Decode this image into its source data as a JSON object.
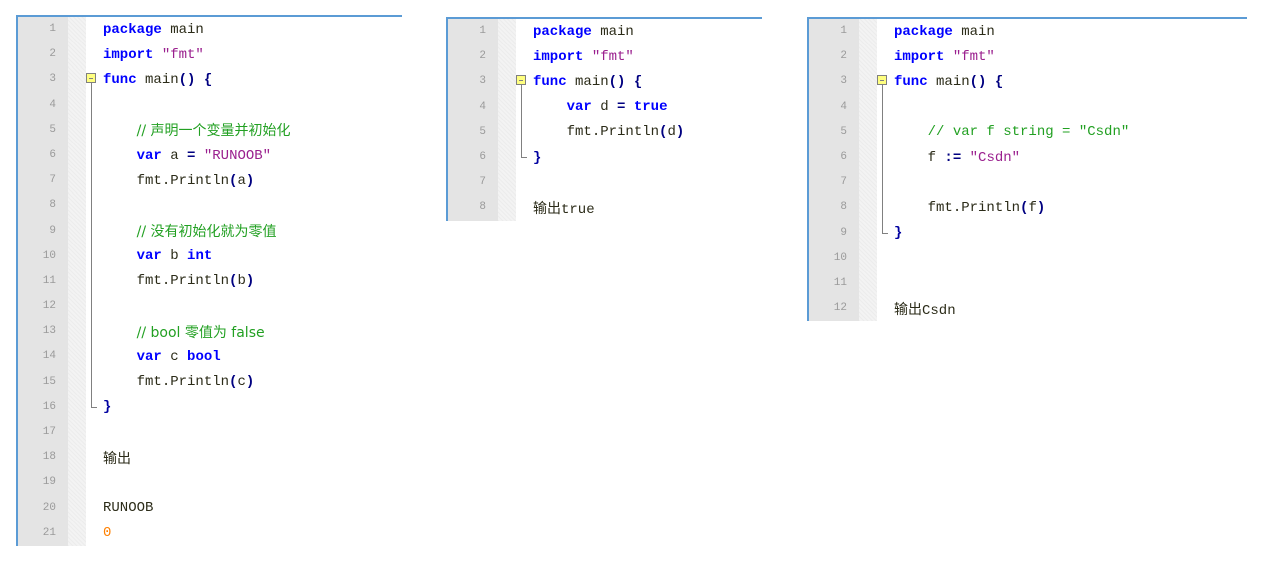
{
  "colors": {
    "panel_border": "#5b9bd5",
    "gutter_bg": "#e4e4e4",
    "line_number": "#9a9a9a",
    "keyword": "#0000ff",
    "string": "#9a1f8e",
    "comment": "#22a022",
    "number": "#ff8000",
    "fold_marker": "#ffff80"
  },
  "panels": [
    {
      "name": "editor-panel-variables",
      "lines": [
        {
          "n": "1",
          "fold": "",
          "indent": "",
          "tokens": [
            [
              "kw",
              "package"
            ],
            [
              "plain",
              " main"
            ]
          ]
        },
        {
          "n": "2",
          "fold": "",
          "indent": "",
          "tokens": [
            [
              "kw",
              "import"
            ],
            [
              "plain",
              " "
            ],
            [
              "str",
              "\"fmt\""
            ]
          ]
        },
        {
          "n": "3",
          "fold": "start",
          "indent": "",
          "tokens": [
            [
              "kw",
              "func"
            ],
            [
              "plain",
              " main"
            ],
            [
              "op",
              "()"
            ],
            [
              "plain",
              " "
            ],
            [
              "op",
              "{"
            ]
          ]
        },
        {
          "n": "4",
          "fold": "mid",
          "indent": "",
          "tokens": []
        },
        {
          "n": "5",
          "fold": "mid",
          "indent": "    ",
          "tokens": [
            [
              "com",
              "// 声明一个变量并初始化"
            ]
          ]
        },
        {
          "n": "6",
          "fold": "mid",
          "indent": "    ",
          "tokens": [
            [
              "kw",
              "var"
            ],
            [
              "plain",
              " a "
            ],
            [
              "op",
              "="
            ],
            [
              "plain",
              " "
            ],
            [
              "str",
              "\"RUNOOB\""
            ]
          ]
        },
        {
          "n": "7",
          "fold": "mid",
          "indent": "    ",
          "tokens": [
            [
              "plain",
              "fmt.Println"
            ],
            [
              "op",
              "("
            ],
            [
              "plain",
              "a"
            ],
            [
              "op",
              ")"
            ]
          ]
        },
        {
          "n": "8",
          "fold": "mid",
          "indent": "",
          "tokens": []
        },
        {
          "n": "9",
          "fold": "mid",
          "indent": "    ",
          "tokens": [
            [
              "com",
              "// 没有初始化就为零值"
            ]
          ]
        },
        {
          "n": "10",
          "fold": "mid",
          "indent": "    ",
          "tokens": [
            [
              "kw",
              "var"
            ],
            [
              "plain",
              " b "
            ],
            [
              "kw",
              "int"
            ]
          ]
        },
        {
          "n": "11",
          "fold": "mid",
          "indent": "    ",
          "tokens": [
            [
              "plain",
              "fmt.Println"
            ],
            [
              "op",
              "("
            ],
            [
              "plain",
              "b"
            ],
            [
              "op",
              ")"
            ]
          ]
        },
        {
          "n": "12",
          "fold": "mid",
          "indent": "",
          "tokens": []
        },
        {
          "n": "13",
          "fold": "mid",
          "indent": "    ",
          "tokens": [
            [
              "com",
              "// bool 零值为 false"
            ]
          ]
        },
        {
          "n": "14",
          "fold": "mid",
          "indent": "    ",
          "tokens": [
            [
              "kw",
              "var"
            ],
            [
              "plain",
              " c "
            ],
            [
              "kw",
              "bool"
            ]
          ]
        },
        {
          "n": "15",
          "fold": "mid",
          "indent": "    ",
          "tokens": [
            [
              "plain",
              "fmt.Println"
            ],
            [
              "op",
              "("
            ],
            [
              "plain",
              "c"
            ],
            [
              "op",
              ")"
            ]
          ]
        },
        {
          "n": "16",
          "fold": "end",
          "indent": "",
          "tokens": [
            [
              "brace",
              "}"
            ]
          ]
        },
        {
          "n": "17",
          "fold": "",
          "indent": "",
          "tokens": []
        },
        {
          "n": "18",
          "fold": "",
          "indent": "",
          "tokens": [
            [
              "out",
              "输出"
            ]
          ]
        },
        {
          "n": "19",
          "fold": "",
          "indent": "",
          "tokens": []
        },
        {
          "n": "20",
          "fold": "",
          "indent": "",
          "tokens": [
            [
              "out",
              "RUNOOB"
            ]
          ]
        },
        {
          "n": "21",
          "fold": "",
          "indent": "",
          "tokens": [
            [
              "num",
              "0"
            ]
          ]
        }
      ]
    },
    {
      "name": "editor-panel-bool",
      "lines": [
        {
          "n": "1",
          "fold": "",
          "indent": "",
          "tokens": [
            [
              "kw",
              "package"
            ],
            [
              "plain",
              " main"
            ]
          ]
        },
        {
          "n": "2",
          "fold": "",
          "indent": "",
          "tokens": [
            [
              "kw",
              "import"
            ],
            [
              "plain",
              " "
            ],
            [
              "str",
              "\"fmt\""
            ]
          ]
        },
        {
          "n": "3",
          "fold": "start",
          "indent": "",
          "tokens": [
            [
              "kw",
              "func"
            ],
            [
              "plain",
              " main"
            ],
            [
              "op",
              "()"
            ],
            [
              "plain",
              " "
            ],
            [
              "op",
              "{"
            ]
          ]
        },
        {
          "n": "4",
          "fold": "mid",
          "indent": "    ",
          "tokens": [
            [
              "kw",
              "var"
            ],
            [
              "plain",
              " d "
            ],
            [
              "op",
              "="
            ],
            [
              "plain",
              " "
            ],
            [
              "kw",
              "true"
            ]
          ]
        },
        {
          "n": "5",
          "fold": "mid",
          "indent": "    ",
          "tokens": [
            [
              "plain",
              "fmt.Println"
            ],
            [
              "op",
              "("
            ],
            [
              "plain",
              "d"
            ],
            [
              "op",
              ")"
            ]
          ]
        },
        {
          "n": "6",
          "fold": "end",
          "indent": "",
          "tokens": [
            [
              "brace",
              "}"
            ]
          ]
        },
        {
          "n": "7",
          "fold": "",
          "indent": "",
          "tokens": []
        },
        {
          "n": "8",
          "fold": "",
          "indent": "",
          "tokens": [
            [
              "out",
              "输出"
            ],
            [
              "plain",
              "true"
            ]
          ]
        }
      ]
    },
    {
      "name": "editor-panel-short-decl",
      "lines": [
        {
          "n": "1",
          "fold": "",
          "indent": "",
          "tokens": [
            [
              "kw",
              "package"
            ],
            [
              "plain",
              " main"
            ]
          ]
        },
        {
          "n": "2",
          "fold": "",
          "indent": "",
          "tokens": [
            [
              "kw",
              "import"
            ],
            [
              "plain",
              " "
            ],
            [
              "str",
              "\"fmt\""
            ]
          ]
        },
        {
          "n": "3",
          "fold": "start",
          "indent": "",
          "tokens": [
            [
              "kw",
              "func"
            ],
            [
              "plain",
              " main"
            ],
            [
              "op",
              "()"
            ],
            [
              "plain",
              " "
            ],
            [
              "op",
              "{"
            ]
          ]
        },
        {
          "n": "4",
          "fold": "mid",
          "indent": "",
          "tokens": []
        },
        {
          "n": "5",
          "fold": "mid",
          "indent": "    ",
          "tokens": [
            [
              "com",
              "// var f string = \"Csdn\""
            ]
          ]
        },
        {
          "n": "6",
          "fold": "mid",
          "indent": "    ",
          "tokens": [
            [
              "plain",
              "f "
            ],
            [
              "op",
              ":="
            ],
            [
              "plain",
              " "
            ],
            [
              "str",
              "\"Csdn\""
            ]
          ]
        },
        {
          "n": "7",
          "fold": "mid",
          "indent": "",
          "tokens": []
        },
        {
          "n": "8",
          "fold": "mid",
          "indent": "    ",
          "tokens": [
            [
              "plain",
              "fmt.Println"
            ],
            [
              "op",
              "("
            ],
            [
              "plain",
              "f"
            ],
            [
              "op",
              ")"
            ]
          ]
        },
        {
          "n": "9",
          "fold": "end",
          "indent": "",
          "tokens": [
            [
              "brace",
              "}"
            ]
          ]
        },
        {
          "n": "10",
          "fold": "",
          "indent": "",
          "tokens": []
        },
        {
          "n": "11",
          "fold": "",
          "indent": "",
          "tokens": []
        },
        {
          "n": "12",
          "fold": "",
          "indent": "",
          "tokens": [
            [
              "out",
              "输出"
            ],
            [
              "plain",
              "Csdn"
            ]
          ]
        }
      ]
    }
  ]
}
